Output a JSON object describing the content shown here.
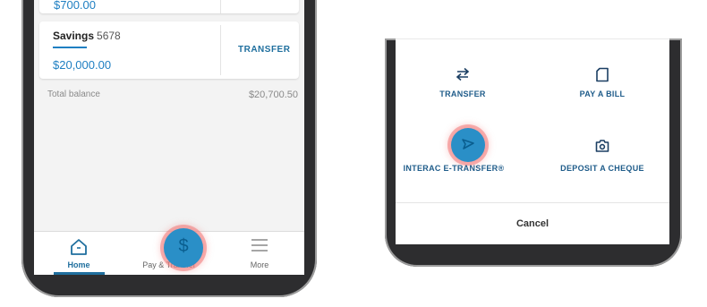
{
  "left_screen": {
    "top_card_amount": "$700.00",
    "savings": {
      "name": "Savings",
      "number": "5678",
      "amount": "$20,000.00",
      "action": "TRANSFER"
    },
    "total_label": "Total balance",
    "total_value": "$20,700.50",
    "nav": {
      "home": "Home",
      "pay_transfer": "Pay & Transfer",
      "more": "More"
    }
  },
  "right_screen": {
    "actions": {
      "transfer": "TRANSFER",
      "pay_bill": "PAY A BILL",
      "interac": "INTERAC E-TRANSFER®",
      "deposit": "DEPOSIT A CHEQUE"
    },
    "cancel": "Cancel"
  },
  "colors": {
    "accent": "#1f7fc2",
    "nav_active": "#1f6f9e",
    "tap_highlight": "#2a8fc7"
  }
}
